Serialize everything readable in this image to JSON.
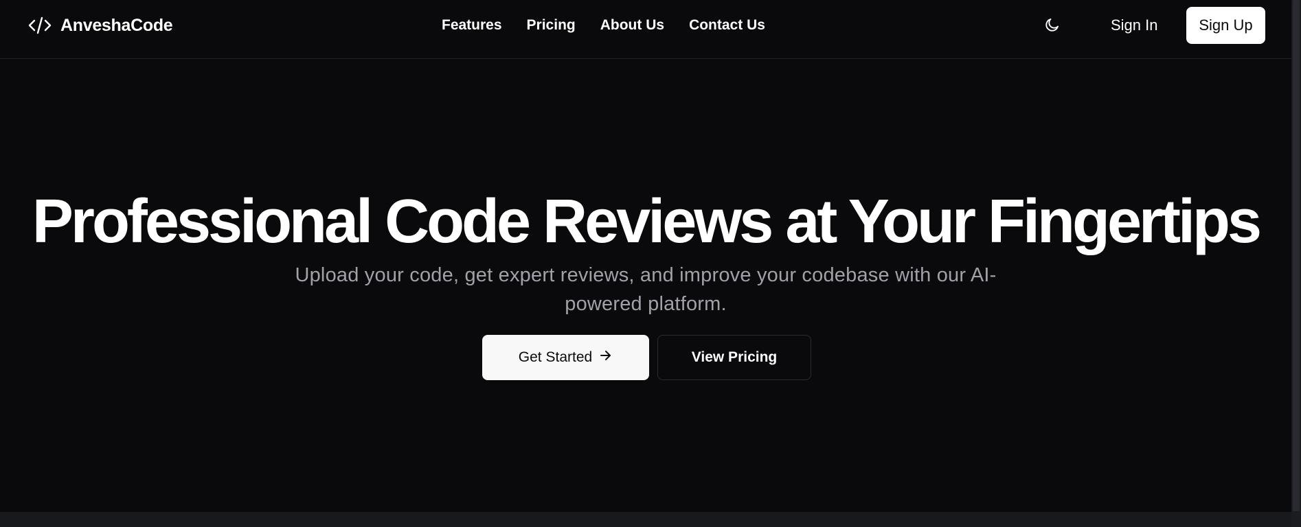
{
  "header": {
    "brand_name": "AnveshaCode",
    "brand_icon": "code-icon",
    "nav": [
      {
        "label": "Features"
      },
      {
        "label": "Pricing"
      },
      {
        "label": "About Us"
      },
      {
        "label": "Contact Us"
      }
    ],
    "theme_icon": "moon-icon",
    "sign_in_label": "Sign In",
    "sign_up_label": "Sign Up"
  },
  "hero": {
    "title": "Professional Code Reviews at Your Fingertips",
    "subtitle": "Upload your code, get expert reviews, and improve your codebase with our AI-powered platform.",
    "primary_cta": "Get Started",
    "primary_cta_icon": "arrow-right-icon",
    "secondary_cta": "View Pricing"
  },
  "colors": {
    "background": "#0a0a0c",
    "text": "#ffffff",
    "muted_text": "#a1a1aa",
    "primary_button_bg": "#f8f8f8",
    "border": "#2a2b30"
  }
}
